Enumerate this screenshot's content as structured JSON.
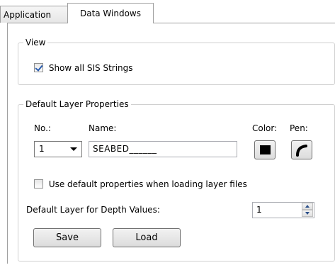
{
  "tabs": [
    {
      "label": "Application",
      "active": false
    },
    {
      "label": "Data Windows",
      "active": true
    }
  ],
  "view_group": {
    "title": "View",
    "show_sis_label": "Show all SIS Strings",
    "show_sis_checked": true
  },
  "layer_group": {
    "title": "Default Layer Properties",
    "no_label": "No.:",
    "name_label": "Name:",
    "color_label": "Color:",
    "pen_label": "Pen:",
    "no_value": "1",
    "name_value": "SEABED______",
    "color_value": "#000000",
    "use_default_label": "Use default properties when loading layer files",
    "use_default_checked": false,
    "depth_label": "Default Layer for Depth Values:",
    "depth_value": "1",
    "save_label": "Save",
    "load_label": "Load"
  },
  "icons": {
    "color_button": "color-swatch-icon",
    "pen_button": "pen-curve-icon",
    "spin": "up-down-arrows-icon"
  }
}
